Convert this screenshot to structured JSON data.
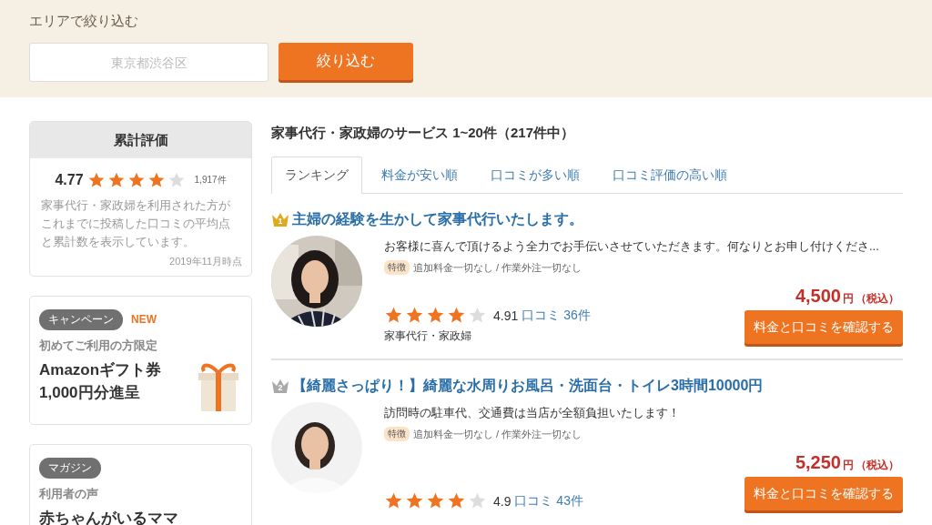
{
  "filter": {
    "label": "エリアで絞り込む",
    "placeholder": "東京都渋谷区",
    "button": "絞り込む"
  },
  "summary": {
    "title": "累計評価",
    "score": "4.77",
    "stars": 4,
    "count": "1,917件",
    "description": "家事代行・家政婦を利用された方がこれまでに投稿した口コミの平均点と累計数を表示しています。",
    "date": "2019年11月時点"
  },
  "campaign": {
    "tag": "キャンペーン",
    "badge": "NEW",
    "subtitle": "初めてご利用の方限定",
    "title_lines": [
      "Amazonギフト券",
      "1,000円分進呈"
    ]
  },
  "magazine": {
    "tag": "マガジン",
    "subtitle": "利用者の声",
    "title": "赤ちゃんがいるママ"
  },
  "results": {
    "heading": "家事代行・家政婦のサービス 1~20件（217件中）",
    "tabs": [
      {
        "label": "ランキング",
        "selected": true
      },
      {
        "label": "料金が安い順",
        "selected": false
      },
      {
        "label": "口コミが多い順",
        "selected": false
      },
      {
        "label": "口コミ評価の高い順",
        "selected": false
      }
    ],
    "items": [
      {
        "rank": "1",
        "color": "#e0a81c",
        "title": "主婦の経験を生かして家事代行いたします。",
        "description": "お客様に喜んで頂けるよう全力でお手伝いさせていただきます。何なりとお申し付けくださ...",
        "feature_tag": "特徴",
        "features": "追加料金一切なし / 作業外注一切なし",
        "stars": 4,
        "score": "4.91",
        "reviews": "口コミ 36件",
        "category": "家事代行・家政婦",
        "price": "4,500",
        "price_unit": "円",
        "tax": "（税込）",
        "button": "料金と口コミを確認する"
      },
      {
        "rank": "2",
        "color": "#a9a9a9",
        "title": "【綺麗さっぱり！】綺麗な水周りお風呂・洗面台・トイレ3時間10000円",
        "description": "訪問時の駐車代、交通費は当店が全額負担いたします！",
        "feature_tag": "特徴",
        "features": "追加料金一切なし / 作業外注一切なし",
        "stars": 4,
        "score": "4.9",
        "reviews": "口コミ 43件",
        "price": "5,250",
        "price_unit": "円",
        "tax": "（税込）",
        "button": "料金と口コミを確認する"
      }
    ]
  }
}
